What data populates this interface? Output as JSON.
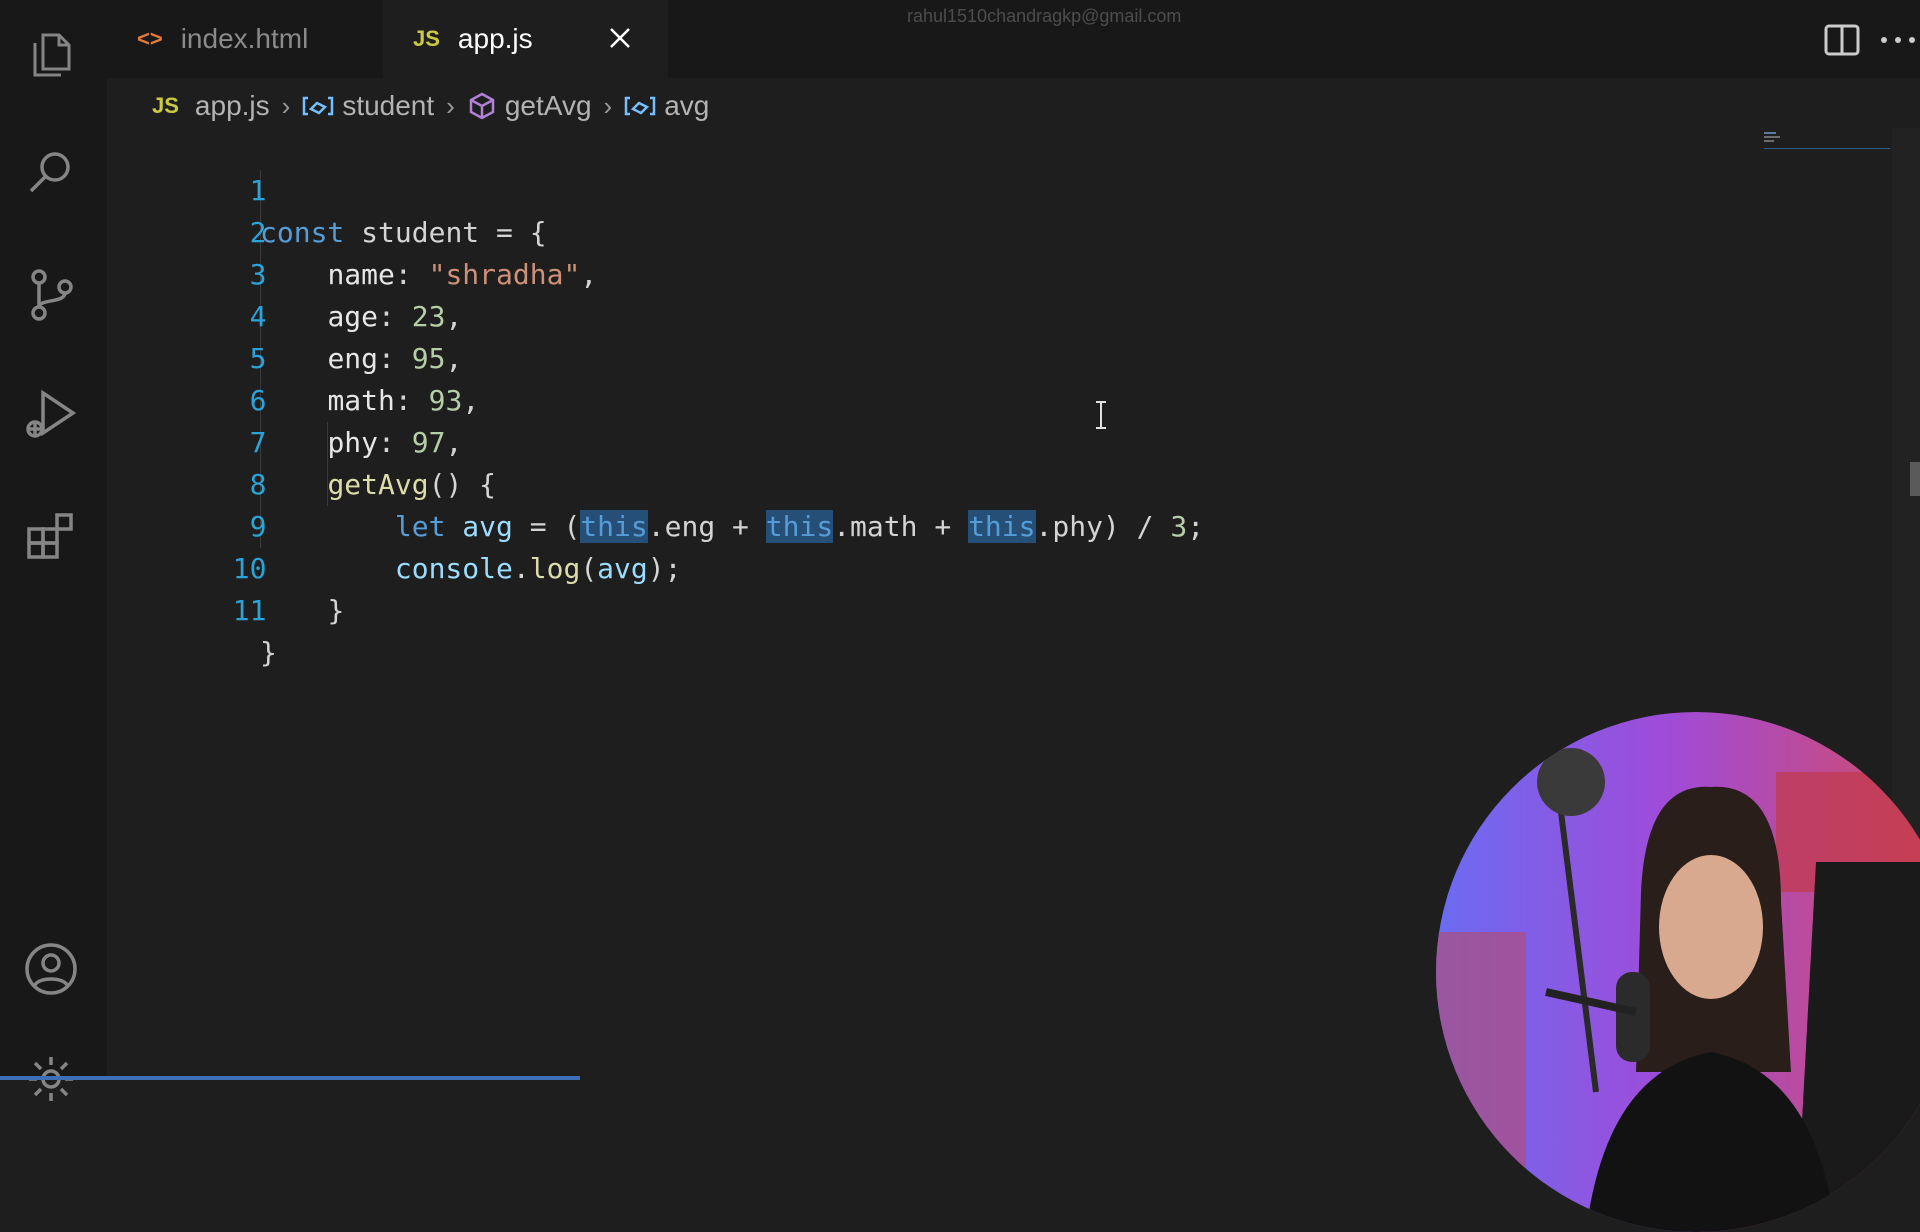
{
  "window": {
    "account_email": "rahul1510chandragkp@gmail.com"
  },
  "tabs": [
    {
      "label": "index.html",
      "icon": "html-file-icon",
      "icon_text": "<>"
    },
    {
      "label": "app.js",
      "icon": "js-file-icon",
      "icon_text": "JS"
    }
  ],
  "breadcrumb": {
    "file_icon_text": "JS",
    "file": "app.js",
    "items": [
      "student",
      "getAvg",
      "avg"
    ]
  },
  "editor": {
    "line_numbers": [
      "1",
      "2",
      "3",
      "4",
      "5",
      "6",
      "7",
      "8",
      "9",
      "10",
      "11"
    ],
    "lines": [
      "const student = {",
      "    name: \"shradha\",",
      "    age: 23,",
      "    eng: 95,",
      "    math: 93,",
      "    phy: 97,",
      "    getAvg() {",
      "        let avg = (this.eng + this.math + this.phy) / 3;",
      "        console.log(avg);",
      "    }",
      "}"
    ]
  },
  "colors": {
    "keyword": "#569cd6",
    "string": "#ce9178",
    "number": "#b5cea8",
    "function": "#dcdcaa",
    "line_number": "#2aa3d8",
    "highlight": "#264f78",
    "editor_bg": "#1e1e1e",
    "sidebar_bg": "#181818"
  },
  "activity_bar": [
    "explorer-icon",
    "search-icon",
    "source-control-icon",
    "run-debug-icon",
    "extensions-icon",
    "account-icon",
    "settings-icon"
  ],
  "webcam": {
    "description_icon": "presenter-webcam"
  }
}
